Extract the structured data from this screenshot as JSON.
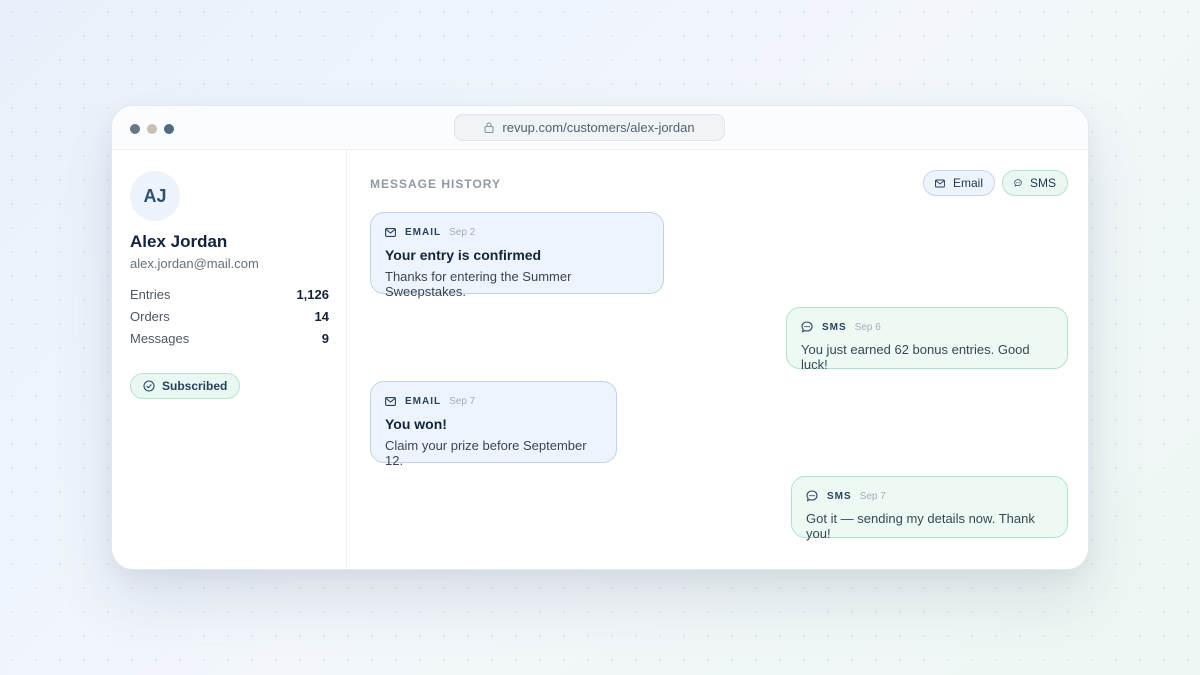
{
  "window": {
    "url": "revup.com/customers/alex-jordan"
  },
  "customer": {
    "initials": "AJ",
    "name": "Alex Jordan",
    "email": "alex.jordan@mail.com",
    "stats": [
      {
        "label": "Entries",
        "value": "1,126"
      },
      {
        "label": "Orders",
        "value": "14"
      },
      {
        "label": "Messages",
        "value": "9"
      }
    ],
    "status": "Subscribed"
  },
  "history": {
    "title": "MESSAGE HISTORY",
    "filters": {
      "email": "Email",
      "sms": "SMS"
    },
    "messages": [
      {
        "channel": "EMAIL",
        "date": "Sep 2",
        "subject": "Your entry is confirmed",
        "body": "Thanks for entering the Summer Sweepstakes."
      },
      {
        "channel": "SMS",
        "date": "Sep 6",
        "body": "You just earned 62 bonus entries. Good luck!"
      },
      {
        "channel": "EMAIL",
        "date": "Sep 7",
        "subject": "You won!",
        "body": "Claim your prize before September 12."
      },
      {
        "channel": "SMS",
        "date": "Sep 7",
        "body": "Got it — sending my details now. Thank you!"
      }
    ]
  },
  "colors": {
    "email_accent": "#eef4fc",
    "sms_accent": "#ecfaf3",
    "brand_dark": "#14233a"
  }
}
